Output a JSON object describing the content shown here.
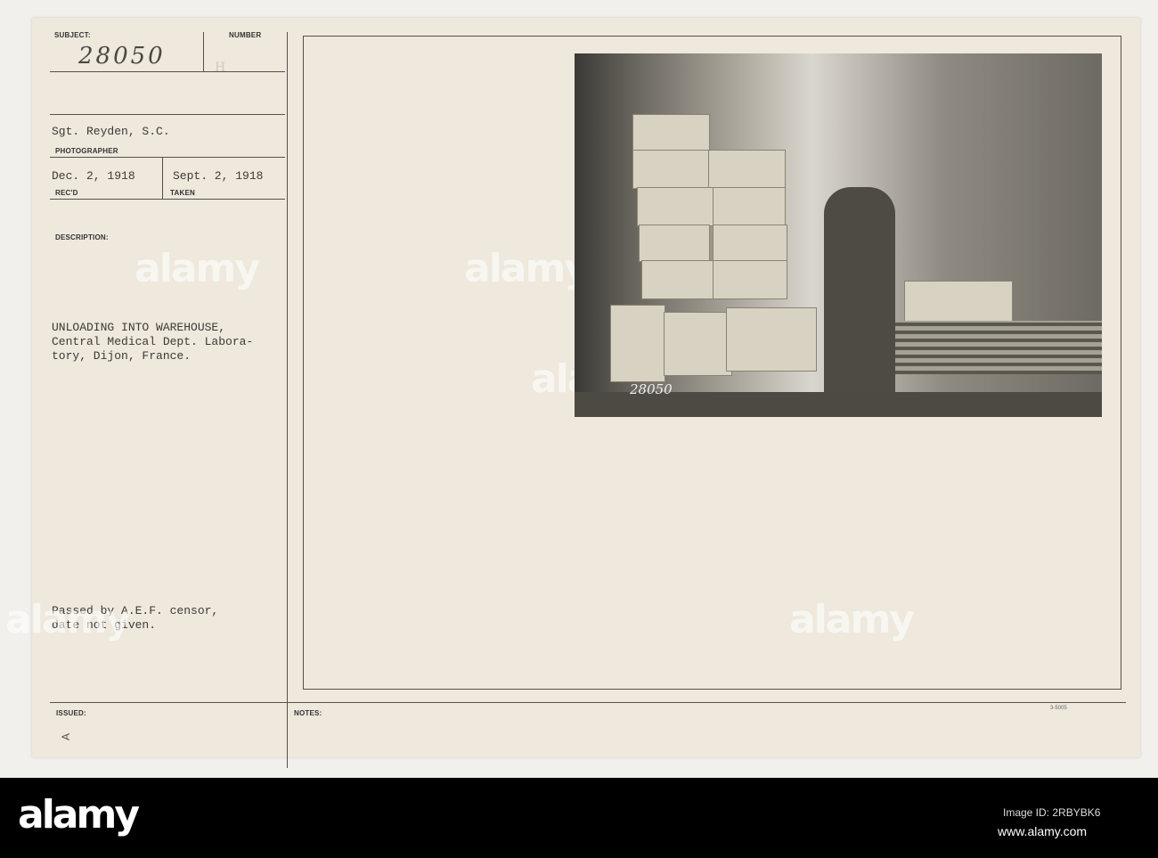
{
  "card": {
    "subject_label": "SUBJECT:",
    "subject_value": "28050",
    "number_label": "NUMBER",
    "number_stamp": "H",
    "photographer_value": "Sgt. Reyden, S.C.",
    "photographer_label": "PHOTOGRAPHER",
    "received_value": "Dec. 2, 1918",
    "received_label": "REC'D",
    "taken_value": "Sept. 2, 1918",
    "taken_label": "TAKEN",
    "description_label": "DESCRIPTION:",
    "description_lines": [
      "UNLOADING INTO WAREHOUSE,",
      "Central Medical Dept. Labora-",
      "tory, Dijon, France."
    ],
    "censor_lines": [
      "Passed by A.E.F. censor,",
      "date not given."
    ],
    "issued_label": "ISSUED:",
    "issued_mark": "A",
    "notes_label": "NOTES:",
    "form_number": "3-5005",
    "photo_caption": "28050"
  },
  "watermark": "alamy",
  "footer": {
    "logo": "alamy",
    "image_id": "Image ID: 2RBYBK6",
    "url": "www.alamy.com"
  }
}
